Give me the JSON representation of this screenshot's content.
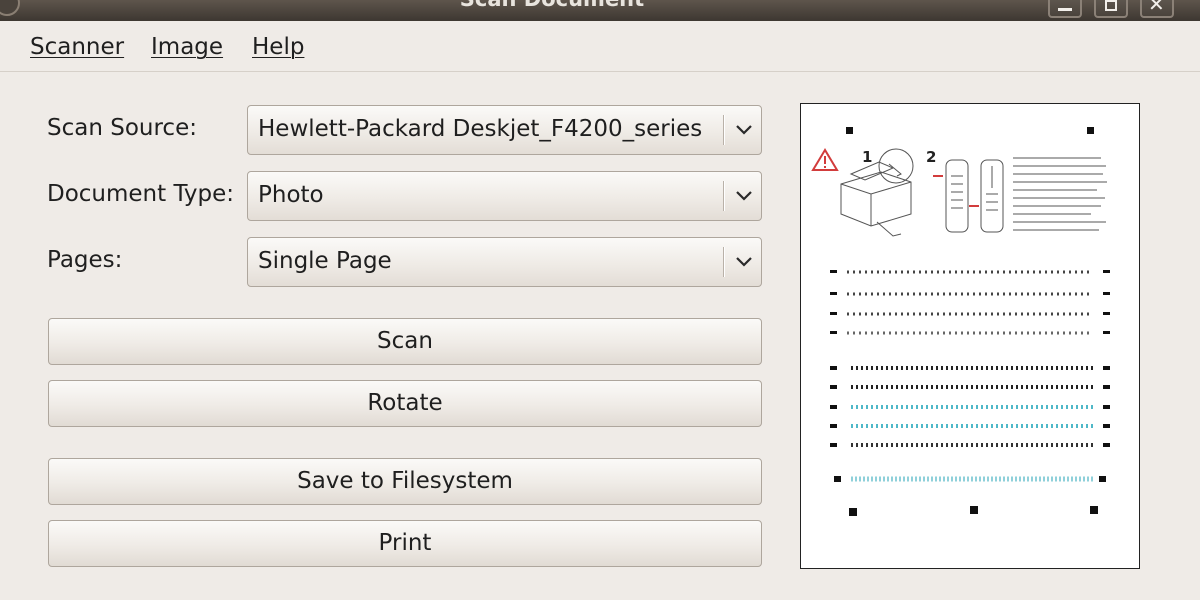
{
  "window": {
    "title": "Scan Document"
  },
  "menu": [
    {
      "label": "Scanner"
    },
    {
      "label": "Image"
    },
    {
      "label": "Help"
    }
  ],
  "form": {
    "scan_source": {
      "label": "Scan Source:",
      "value": "Hewlett-Packard Deskjet_F4200_series"
    },
    "document_type": {
      "label": "Document Type:",
      "value": "Photo"
    },
    "pages": {
      "label": "Pages:",
      "value": "Single Page"
    }
  },
  "buttons": {
    "scan": "Scan",
    "rotate": "Rotate",
    "save": "Save to Filesystem",
    "print": "Print"
  },
  "preview": {
    "step_labels": [
      "1",
      "2"
    ]
  },
  "colors": {
    "window_bg": "#efebe7",
    "titlebar": "#3d3731",
    "cyan_rows": "#4fb8c8"
  }
}
